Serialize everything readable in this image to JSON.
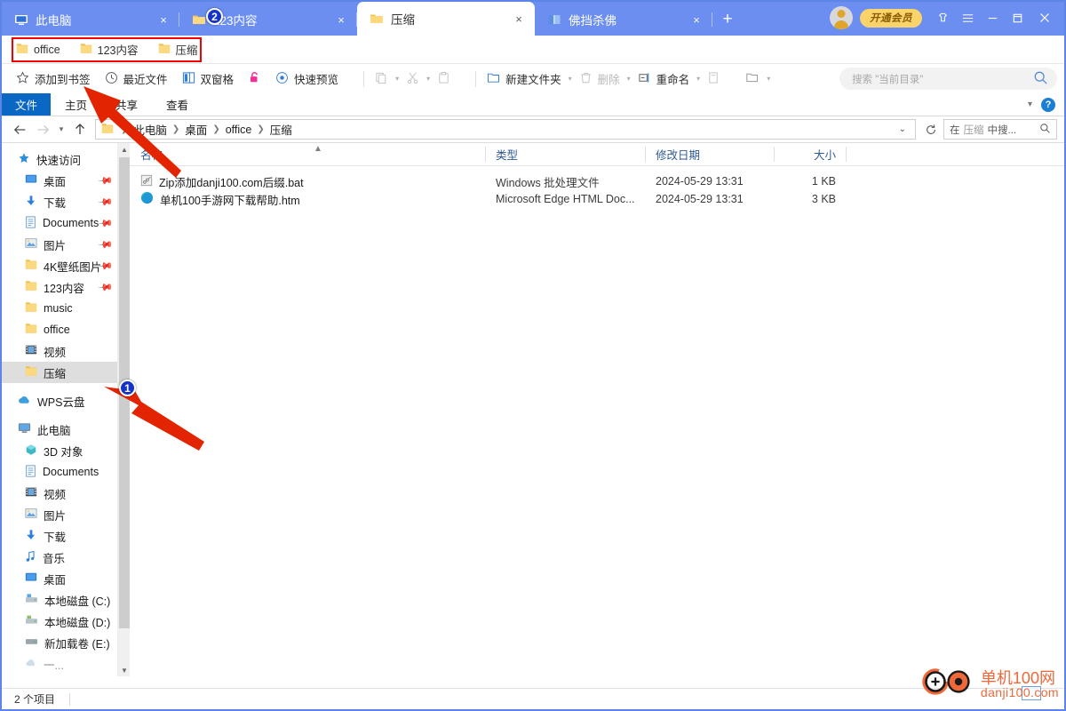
{
  "window": {
    "tabs": [
      {
        "title": "此电脑",
        "icon": "computer-icon",
        "active": false
      },
      {
        "title": "123内容",
        "icon": "folder-icon",
        "active": false
      },
      {
        "title": "压缩",
        "icon": "folder-icon",
        "active": true
      },
      {
        "title": "佛挡杀佛",
        "icon": "dual-pane-icon",
        "active": false
      }
    ],
    "new_tab_label": "+",
    "close_label": "×",
    "vip_label": "开通会员",
    "controls": {
      "shirt": "⌂",
      "menu": "☰",
      "minimize": "—",
      "maximize": "❐",
      "close": "✕"
    },
    "titlebar_color": "#6b8ef0"
  },
  "bookmarks": {
    "items": [
      {
        "label": "office"
      },
      {
        "label": "123内容"
      },
      {
        "label": "压缩"
      }
    ],
    "highlight_color": "#f40000"
  },
  "annotations": {
    "badge1": "1",
    "badge2": "2",
    "badge_color": "#1633c8",
    "arrow_color": "#e32400"
  },
  "quick_toolbar": {
    "items": [
      {
        "label": "添加到书签",
        "icon": "star-icon",
        "dim": false
      },
      {
        "label": "最近文件",
        "icon": "clock-icon",
        "dim": false
      },
      {
        "label": "双窗格",
        "icon": "dual-pane-icon",
        "dim": false
      },
      {
        "label": "",
        "icon": "unlock-icon",
        "dim": false
      },
      {
        "label": "快速预览",
        "icon": "preview-eye-icon",
        "dim": false
      }
    ],
    "clipboard_items": [
      {
        "icon": "copy-icon",
        "dim": true
      },
      {
        "icon": "cut-icon",
        "dim": true
      },
      {
        "icon": "paste-icon",
        "dim": true
      }
    ],
    "actions": [
      {
        "label": "新建文件夹",
        "icon": "new-folder-icon",
        "dim": false
      },
      {
        "label": "删除",
        "icon": "trash-icon",
        "dim": true
      },
      {
        "label": "重命名",
        "icon": "rename-icon",
        "dim": false
      }
    ],
    "search": {
      "placeholder": "搜索 \"当前目录\"",
      "icon": "search-icon"
    }
  },
  "ribbon": {
    "tabs": [
      {
        "label": "文件",
        "active": true
      },
      {
        "label": "主页",
        "active": false
      },
      {
        "label": "共享",
        "active": false
      },
      {
        "label": "查看",
        "active": false
      }
    ],
    "collapse_icon": "chevron-down-icon",
    "help_label": "?"
  },
  "address_bar": {
    "back_icon": "back-arrow-icon",
    "forward_icon": "forward-arrow-icon",
    "history_icon": "chevron-down-icon",
    "up_icon": "up-arrow-icon",
    "breadcrumbs": [
      "此电脑",
      "桌面",
      "office",
      "压缩"
    ],
    "dropdown_icon": "chevron-down-icon",
    "refresh_icon": "refresh-icon",
    "folder_search": {
      "prefix": "在",
      "target": "压缩",
      "suffix": "中搜...",
      "icon": "search-icon"
    }
  },
  "navigation": {
    "sections": [
      {
        "header": {
          "label": "快速访问",
          "icon": "star-pin-icon"
        },
        "items": [
          {
            "label": "桌面",
            "icon": "desktop-icon",
            "pinned": true
          },
          {
            "label": "下载",
            "icon": "download-icon",
            "pinned": true
          },
          {
            "label": "Documents",
            "icon": "documents-icon",
            "pinned": true
          },
          {
            "label": "图片",
            "icon": "pictures-icon",
            "pinned": true
          },
          {
            "label": "4K壁纸图片",
            "icon": "folder-icon",
            "pinned": true
          },
          {
            "label": "123内容",
            "icon": "folder-icon",
            "pinned": true
          },
          {
            "label": "music",
            "icon": "folder-icon",
            "pinned": false
          },
          {
            "label": "office",
            "icon": "folder-icon",
            "pinned": false
          },
          {
            "label": "视频",
            "icon": "video-icon",
            "pinned": false
          },
          {
            "label": "压缩",
            "icon": "folder-icon",
            "pinned": false,
            "selected": true
          }
        ]
      },
      {
        "header": {
          "label": "WPS云盘",
          "icon": "cloud-icon"
        },
        "items": []
      },
      {
        "header": {
          "label": "此电脑",
          "icon": "computer-icon"
        },
        "items": [
          {
            "label": "3D 对象",
            "icon": "3d-object-icon"
          },
          {
            "label": "Documents",
            "icon": "documents-icon"
          },
          {
            "label": "视频",
            "icon": "video-icon"
          },
          {
            "label": "图片",
            "icon": "pictures-icon"
          },
          {
            "label": "下载",
            "icon": "download-icon"
          },
          {
            "label": "音乐",
            "icon": "music-icon"
          },
          {
            "label": "桌面",
            "icon": "desktop-icon"
          },
          {
            "label": "本地磁盘 (C:)",
            "icon": "system-drive-icon"
          },
          {
            "label": "本地磁盘 (D:)",
            "icon": "drive-icon"
          },
          {
            "label": "新加载卷 (E:)",
            "icon": "drive-icon"
          }
        ]
      }
    ]
  },
  "file_list": {
    "columns": [
      {
        "label": "名称",
        "key": "name"
      },
      {
        "label": "类型",
        "key": "type"
      },
      {
        "label": "修改日期",
        "key": "date"
      },
      {
        "label": "大小",
        "key": "size"
      }
    ],
    "sort_indicator": "▲",
    "rows": [
      {
        "name": "Zip添加danji100.com后缀.bat",
        "icon": "bat-file-icon",
        "type": "Windows 批处理文件",
        "date": "2024-05-29 13:31",
        "size": "1 KB"
      },
      {
        "name": "单机100手游网下载帮助.htm",
        "icon": "edge-html-icon",
        "type": "Microsoft Edge HTML Doc...",
        "date": "2024-05-29 13:31",
        "size": "3 KB"
      }
    ]
  },
  "status_bar": {
    "count_label": "2 个项目"
  },
  "watermark": {
    "line1": "单机100网",
    "line2": "danji100.com",
    "color": "#f0683a"
  }
}
